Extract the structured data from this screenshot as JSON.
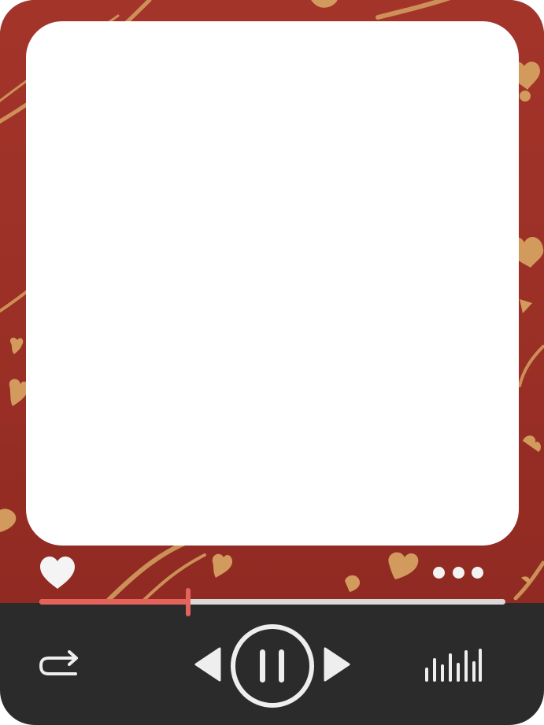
{
  "player": {
    "progress_fraction": 0.32,
    "state": "playing"
  },
  "icons": {
    "like": "heart-icon",
    "more": "more-dots-icon",
    "repeat": "repeat-icon",
    "previous": "previous-triangle-icon",
    "pause": "pause-icon",
    "next": "next-triangle-icon",
    "equalizer": "equalizer-icon"
  },
  "colors": {
    "frame_red": "#9d3128",
    "gold_pattern": "#d39a5e",
    "control_bar": "#2b2b2b",
    "icon_light": "#eeeeee",
    "progress_fill": "#e4635a",
    "progress_track": "#d9d9d9"
  }
}
